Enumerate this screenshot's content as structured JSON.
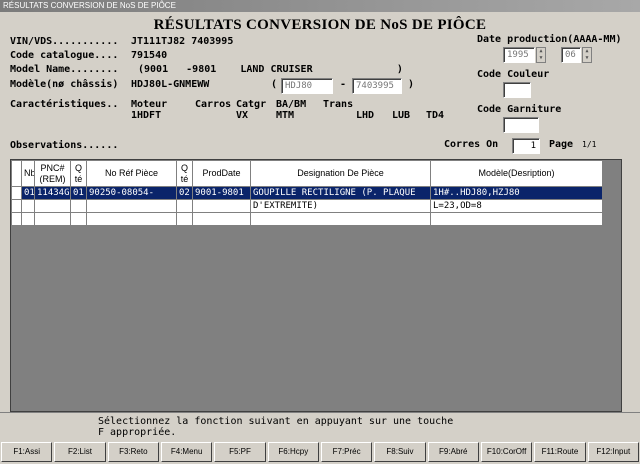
{
  "window": {
    "title": "RÉSULTATS CONVERSION DE NoS DE PIÔCE"
  },
  "heading": "RÉSULTATS CONVERSION DE NoS DE PIÔCE",
  "vin": {
    "label": "VIN/VDS...........",
    "value": "JT111TJ82 7403995"
  },
  "catalogue": {
    "label": "Code catalogue....",
    "value": "791540"
  },
  "model_name": {
    "label": "Model Name........",
    "value": "(9001   -9801    LAND CRUISER              )"
  },
  "modele": {
    "label": "Modèle(nø châssis)",
    "value": "HDJ80L-GNMEWW",
    "paren_open": "(",
    "dash": "-",
    "paren_close": ")",
    "field1": "HDJ80",
    "field2": "7403995"
  },
  "caracteristiques": {
    "label": "Caractéristiques..",
    "cols": [
      {
        "head": "Moteur",
        "val": "1HDFT"
      },
      {
        "head": "Carros",
        "val": ""
      },
      {
        "head": "Catgr",
        "val": "VX"
      },
      {
        "head": "BA/BM",
        "val": "MTM"
      },
      {
        "head": "Trans",
        "val": ""
      }
    ],
    "extra": [
      "LHD",
      "LUB",
      "TD4"
    ]
  },
  "observations": {
    "label": "Observations......"
  },
  "corres": {
    "label": "Corres On",
    "value": "1",
    "page_label": "Page",
    "page_value": "1/1"
  },
  "right_panel": {
    "date_label": "Date production(AAAA-MM)",
    "year": "1995",
    "month": "06",
    "couleur_label": "Code Couleur",
    "garniture_label": "Code Garniture"
  },
  "table": {
    "headers": [
      "Nb",
      "PNC#\n(REM)",
      "Q\nté",
      "No Réf Pièce",
      "Q\nté",
      "ProdDate",
      "Designation De Pièce",
      "Modèle(Desription)"
    ],
    "rows": [
      [
        "01",
        "11434G",
        "01",
        "90250-08054-",
        "02",
        "9001-9801",
        "GOUPILLE RECTILIGNE (P. PLAQUE",
        "1H#..HDJ80,HZJ80"
      ],
      [
        "",
        "",
        "",
        "",
        "",
        "",
        "D'EXTREMITE)",
        "L=23,OD=8"
      ],
      [
        "",
        "",
        "",
        "",
        "",
        "",
        "",
        ""
      ]
    ]
  },
  "status_message": {
    "line1": "Sélectionnez la fonction suivant en appuyant sur une touche",
    "line2": "F appropriée."
  },
  "fkeys": [
    "F1:Assi",
    "F2:List",
    "F3:Reto",
    "F4:Menu",
    "F5:PF",
    "F6:Hcpy",
    "F7:Préc",
    "F8:Suiv",
    "F9:Abré",
    "F10:CorOff",
    "F11:Route",
    "F12:Input"
  ]
}
